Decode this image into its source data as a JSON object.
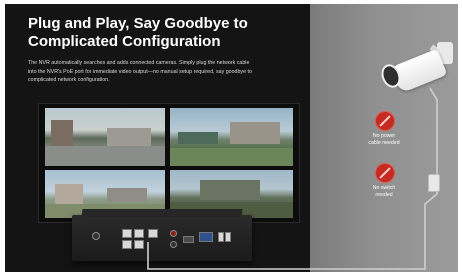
{
  "banner": {
    "headline_line1": "Plug and Play, Say Goodbye to",
    "headline_line2": "Complicated Configuration",
    "body_line1": "The NVR automatically searches and adds connected cameras. Simply plug the network cable",
    "body_line2": "into the NVR's PoE port for immediate video output—no manual setup required, say goodbye to",
    "body_line3": "complicated network configuration."
  },
  "notes": {
    "no_power_line1": "No power",
    "no_power_line2": "cable needed",
    "no_switch_line1": "No switch",
    "no_switch_line2": "needed"
  },
  "icons": {
    "no_power": "no-power-prohibit-icon",
    "no_switch": "no-switch-prohibit-icon"
  },
  "colors": {
    "background_dark": "#141414",
    "panel_gray": "#909090",
    "prohibit_red": "#c42b22",
    "cable": "#d9d9d9"
  }
}
